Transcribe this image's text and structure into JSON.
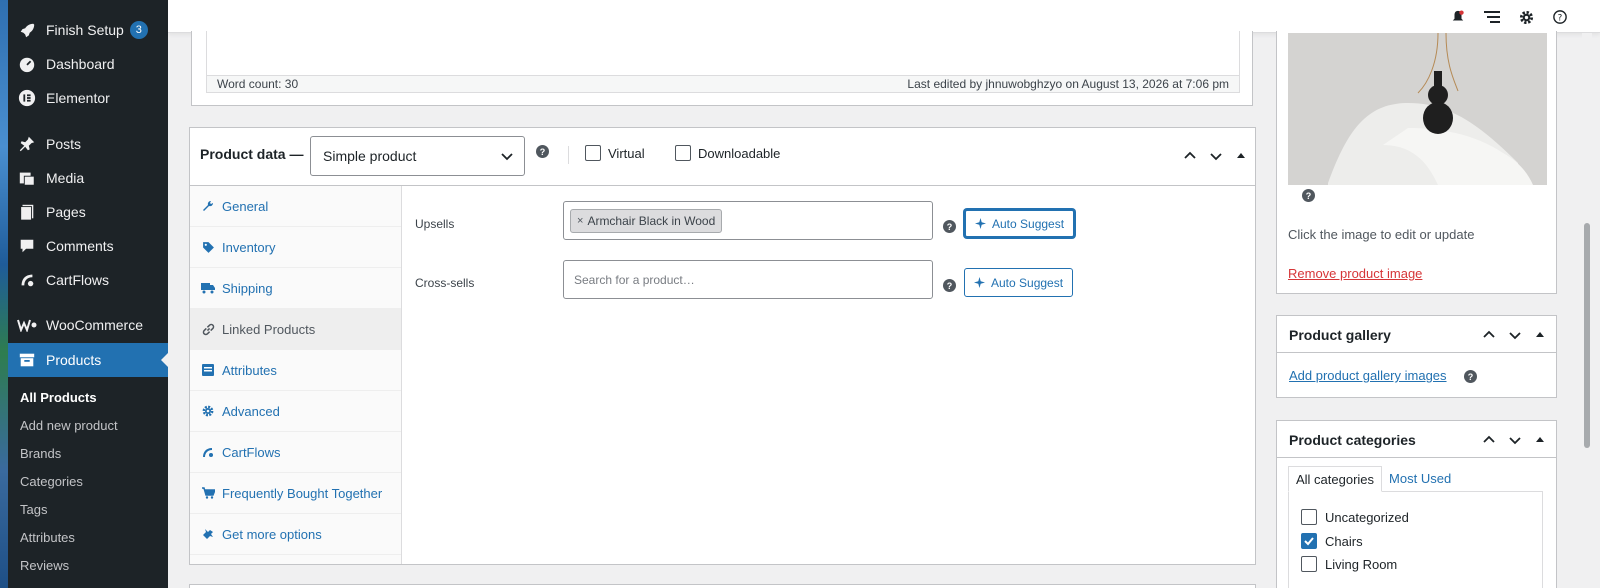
{
  "admin_menu": {
    "items": [
      {
        "label": "Finish Setup",
        "badge": "3",
        "icon": "rocket-icon"
      },
      {
        "label": "Dashboard",
        "icon": "dashboard-icon"
      },
      {
        "label": "Elementor",
        "icon": "elementor-icon"
      },
      {
        "label": "Posts",
        "icon": "pin-icon"
      },
      {
        "label": "Media",
        "icon": "media-icon"
      },
      {
        "label": "Pages",
        "icon": "pages-icon"
      },
      {
        "label": "Comments",
        "icon": "comment-icon"
      },
      {
        "label": "CartFlows",
        "icon": "cartflows-icon"
      },
      {
        "label": "WooCommerce",
        "icon": "woocommerce-icon"
      },
      {
        "label": "Products",
        "icon": "archive-icon"
      }
    ],
    "submenu": [
      "All Products",
      "Add new product",
      "Brands",
      "Categories",
      "Tags",
      "Attributes",
      "Reviews"
    ]
  },
  "editor": {
    "word_count": "Word count: 30",
    "last_edited": "Last edited by jhnuwobghzyo on August 13, 2026 at 7:06 pm"
  },
  "product_data": {
    "title": "Product data —",
    "type_selected": "Simple product",
    "virtual_label": "Virtual",
    "downloadable_label": "Downloadable",
    "tabs": [
      {
        "label": "General",
        "icon": "wrench-icon"
      },
      {
        "label": "Inventory",
        "icon": "tag-icon"
      },
      {
        "label": "Shipping",
        "icon": "truck-icon"
      },
      {
        "label": "Linked Products",
        "icon": "link-icon"
      },
      {
        "label": "Attributes",
        "icon": "list-icon"
      },
      {
        "label": "Advanced",
        "icon": "gear-icon"
      },
      {
        "label": "CartFlows",
        "icon": "cartflows-icon"
      },
      {
        "label": "Frequently Bought Together",
        "icon": "cart-icon"
      },
      {
        "label": "Get more options",
        "icon": "plugin-icon"
      }
    ],
    "linked": {
      "upsells_label": "Upsells",
      "upsells_chip": "Armchair Black in Wood",
      "crosssells_label": "Cross-sells",
      "crosssells_placeholder": "Search for a product…",
      "auto_suggest": "Auto Suggest"
    }
  },
  "product_image": {
    "tip": "Click the image to edit or update",
    "remove": "Remove product image"
  },
  "gallery": {
    "title": "Product gallery",
    "add_link": "Add product gallery images"
  },
  "categories": {
    "title": "Product categories",
    "tab_all": "All categories",
    "tab_used": "Most Used",
    "items": [
      {
        "label": "Uncategorized",
        "checked": false
      },
      {
        "label": "Chairs",
        "checked": true
      },
      {
        "label": "Living Room",
        "checked": false
      }
    ]
  },
  "colors": {
    "accent": "#2271b1",
    "menu_bg": "#1d2327",
    "danger": "#d63638"
  }
}
